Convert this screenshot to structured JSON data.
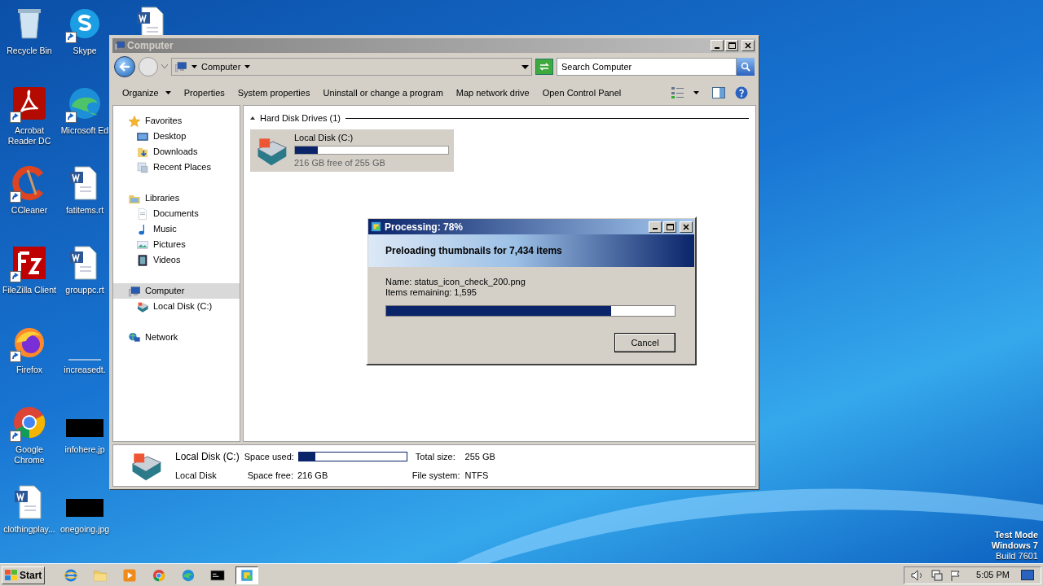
{
  "desktop_icons": [
    {
      "label": "Recycle Bin",
      "kind": "recycle",
      "shortcut": false
    },
    {
      "label": "Skype",
      "kind": "skype",
      "shortcut": true
    },
    {
      "kind": "word",
      "shortcut": false
    },
    {
      "label": "Acrobat Reader DC",
      "kind": "acrobat",
      "shortcut": true
    },
    {
      "label": "Microsoft Ed",
      "kind": "edge",
      "shortcut": true
    },
    {
      "label": "CCleaner",
      "kind": "ccleaner",
      "shortcut": true
    },
    {
      "label": "fatitems.rt",
      "kind": "word",
      "shortcut": false
    },
    {
      "label": "FileZilla Client",
      "kind": "filezilla",
      "shortcut": true
    },
    {
      "label": "grouppc.rt",
      "kind": "word",
      "shortcut": false
    },
    {
      "label": "Firefox",
      "kind": "firefox",
      "shortcut": true
    },
    {
      "label": "increasedt.",
      "kind": "blank",
      "shortcut": false
    },
    {
      "label": "Google Chrome",
      "kind": "chrome",
      "shortcut": true
    },
    {
      "label": "infohere.jp",
      "kind": "image",
      "shortcut": false
    },
    {
      "label": "clothingplay...",
      "kind": "word",
      "shortcut": false
    },
    {
      "label": "onegoing.jpg",
      "kind": "image",
      "shortcut": false
    }
  ],
  "explorer": {
    "title": "Computer",
    "address": "Computer",
    "search": {
      "placeholder": "Search Computer"
    },
    "toolbar": [
      {
        "label": "Organize",
        "dropdown": true
      },
      {
        "label": "Properties",
        "dropdown": false
      },
      {
        "label": "System properties",
        "dropdown": false
      },
      {
        "label": "Uninstall or change a program",
        "dropdown": false
      },
      {
        "label": "Map network drive",
        "dropdown": false
      },
      {
        "label": "Open Control Panel",
        "dropdown": false
      }
    ],
    "nav": [
      {
        "label": "Favorites",
        "kind": "star",
        "selected": false,
        "children": [
          {
            "label": "Desktop",
            "kind": "desktop",
            "selected": false
          },
          {
            "label": "Downloads",
            "kind": "downloads",
            "selected": false
          },
          {
            "label": "Recent Places",
            "kind": "recent",
            "selected": false
          }
        ]
      },
      {
        "label": "Libraries",
        "kind": "libraries",
        "selected": false,
        "children": [
          {
            "label": "Documents",
            "kind": "documents",
            "selected": false
          },
          {
            "label": "Music",
            "kind": "music",
            "selected": false
          },
          {
            "label": "Pictures",
            "kind": "pictures",
            "selected": false
          },
          {
            "label": "Videos",
            "kind": "videos",
            "selected": false
          }
        ]
      },
      {
        "label": "Computer",
        "kind": "computer",
        "selected": true,
        "children": [
          {
            "label": "Local Disk (C:)",
            "kind": "disk",
            "selected": false
          }
        ]
      },
      {
        "label": "Network",
        "kind": "network",
        "selected": false
      }
    ],
    "group": {
      "label": "Hard Disk Drives (1)",
      "expanded": true
    },
    "drives": [
      {
        "name": "Local Disk (C:)",
        "level": 0.15,
        "free": "216 GB free of 255 GB",
        "selected": true
      }
    ],
    "details": {
      "name": "Local Disk (C:)",
      "type": "Local Disk",
      "used_label": "Space used:",
      "level": 0.15,
      "free_label": "Space free:",
      "free": "216 GB",
      "total_label": "Total size:",
      "total": "255 GB",
      "fs_label": "File system:",
      "fs": "NTFS"
    }
  },
  "dialog": {
    "title": "Processing: 78%",
    "heading": "Preloading thumbnails for 7,434 items",
    "lines": [
      "Name: status_icon_check_200.png",
      "Items remaining: 1,595"
    ],
    "level": 0.78,
    "button": "Cancel"
  },
  "taskbar": {
    "start": "Start",
    "apps": [
      {
        "kind": "ie",
        "selected": false
      },
      {
        "kind": "folder",
        "selected": false
      },
      {
        "kind": "media",
        "selected": false
      },
      {
        "kind": "chrome",
        "selected": false
      },
      {
        "kind": "edge",
        "selected": false
      },
      {
        "kind": "cmd",
        "selected": false
      },
      {
        "kind": "app",
        "selected": true
      }
    ],
    "time": "5:05 PM"
  },
  "watermark": [
    "Test Mode",
    "Windows 7",
    "Build 7601"
  ]
}
